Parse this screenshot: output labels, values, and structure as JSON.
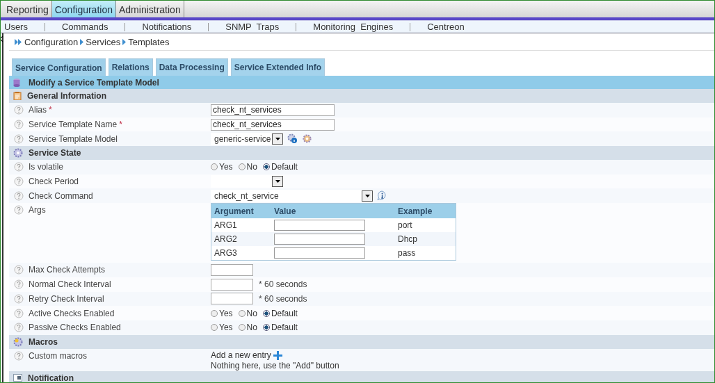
{
  "top_menu": [
    {
      "label": "Reporting",
      "selected": false
    },
    {
      "label": "Configuration",
      "selected": true
    },
    {
      "label": "Administration",
      "selected": false
    }
  ],
  "sub_menu": [
    "Users",
    "Commands",
    "Notifications",
    "SNMP  Traps",
    "Monitoring  Engines",
    "Centreon"
  ],
  "breadcrumb": [
    "Configuration",
    "Services",
    "Templates"
  ],
  "tabs": [
    {
      "label": "Service Configuration",
      "selected": true
    },
    {
      "label": "Relations",
      "selected": false
    },
    {
      "label": "Data Processing",
      "selected": false
    },
    {
      "label": "Service Extended Info",
      "selected": false
    }
  ],
  "form_title": "Modify a Service Template Model",
  "sections": [
    {
      "title": "General Information",
      "fields": [
        {
          "kind": "text",
          "label": "Alias",
          "required_mark": "*",
          "value": "check_nt_services"
        },
        {
          "kind": "text",
          "label": "Service Template Name",
          "required_mark": "*",
          "value": "check_nt_services"
        },
        {
          "kind": "model-select",
          "label": "Service Template Model",
          "value": "generic-service"
        }
      ]
    },
    {
      "title": "Service State",
      "fields": [
        {
          "kind": "radio",
          "label": "Is volatile",
          "options": [
            {
              "label": "Yes",
              "selected": false
            },
            {
              "label": "No",
              "selected": false
            },
            {
              "label": "Default",
              "selected": true
            }
          ]
        },
        {
          "kind": "select",
          "label": "Check Period"
        },
        {
          "kind": "command-select",
          "label": "Check Command",
          "value": "check_nt_service"
        },
        {
          "kind": "args",
          "label": "Args",
          "columns": [
            "Argument",
            "Value",
            "Example"
          ],
          "rows": [
            {
              "argument": "ARG1",
              "example": "port"
            },
            {
              "argument": "ARG2",
              "example": "Dhcp"
            },
            {
              "argument": "ARG3",
              "example": "pass"
            }
          ]
        },
        {
          "kind": "number",
          "label": "Max Check Attempts"
        },
        {
          "kind": "number",
          "label": "Normal Check Interval",
          "unit": "* 60 seconds"
        },
        {
          "kind": "number",
          "label": "Retry Check Interval",
          "unit": "* 60 seconds"
        },
        {
          "kind": "radio",
          "label": "Active Checks Enabled",
          "options": [
            {
              "label": "Yes",
              "selected": false
            },
            {
              "label": "No",
              "selected": false
            },
            {
              "label": "Default",
              "selected": true
            }
          ]
        },
        {
          "kind": "radio",
          "label": "Passive Checks Enabled",
          "options": [
            {
              "label": "Yes",
              "selected": false
            },
            {
              "label": "No",
              "selected": false
            },
            {
              "label": "Default",
              "selected": true
            }
          ]
        }
      ]
    },
    {
      "title": "Macros",
      "fields": [
        {
          "kind": "macros",
          "label": "Custom macros",
          "link": "Add a new entry",
          "note": "Nothing here, use the \"Add\" button"
        }
      ]
    },
    {
      "title": "Notification"
    }
  ]
}
